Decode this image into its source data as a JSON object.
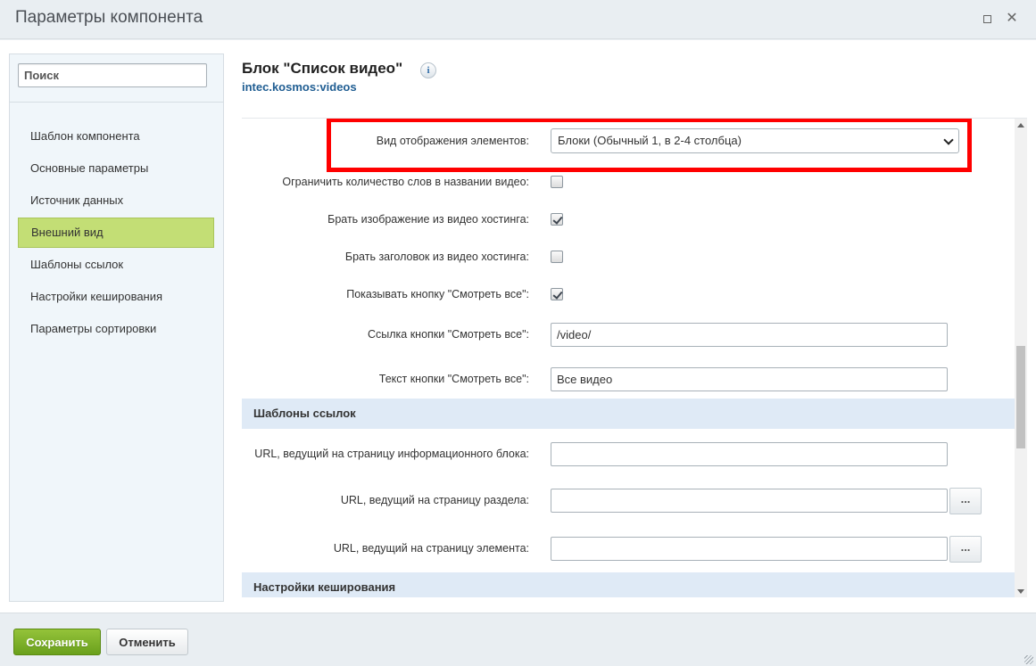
{
  "window": {
    "title": "Параметры компонента",
    "maximize_icon": "maximize-icon",
    "close_glyph": "✕"
  },
  "sidebar": {
    "search_placeholder": "Поиск",
    "items": [
      {
        "label": "Шаблон компонента",
        "active": false
      },
      {
        "label": "Основные параметры",
        "active": false
      },
      {
        "label": "Источник данных",
        "active": false
      },
      {
        "label": "Внешний вид",
        "active": true
      },
      {
        "label": "Шаблоны ссылок",
        "active": false
      },
      {
        "label": "Настройки кеширования",
        "active": false
      },
      {
        "label": "Параметры сортировки",
        "active": false
      }
    ]
  },
  "main": {
    "block_title": "Блок \"Список видео\"",
    "info_glyph": "i",
    "block_code": "intec.kosmos:videos",
    "appearance": {
      "view_mode_label": "Вид отображения элементов:",
      "view_mode_value": "Блоки (Обычный 1, в 2-4 столбца)",
      "limit_words_label": "Ограничить количество слов в названии видео:",
      "limit_words_checked": false,
      "image_from_hosting_label": "Брать изображение из видео хостинга:",
      "image_from_hosting_checked": true,
      "title_from_hosting_label": "Брать заголовок из видео хостинга:",
      "title_from_hosting_checked": false,
      "show_all_button_label": "Показывать кнопку \"Смотреть все\":",
      "show_all_button_checked": true,
      "show_all_link_label": "Ссылка кнопки \"Смотреть все\":",
      "show_all_link_value": "/video/",
      "show_all_text_label": "Текст кнопки \"Смотреть все\":",
      "show_all_text_value": "Все видео"
    },
    "link_templates": {
      "section_title": "Шаблоны ссылок",
      "iblock_url_label": "URL, ведущий на страницу информационного блока:",
      "iblock_url_value": "",
      "section_url_label": "URL, ведущий на страницу раздела:",
      "section_url_value": "",
      "element_url_label": "URL, ведущий на страницу элемента:",
      "element_url_value": "",
      "browse_button": "..."
    },
    "caching": {
      "section_title": "Настройки кеширования"
    }
  },
  "footer": {
    "save_label": "Сохранить",
    "cancel_label": "Отменить"
  },
  "colors": {
    "highlight": "#ff0000",
    "active_nav": "#c3de75",
    "save_button": "#7cb028",
    "section_header": "#dfeaf6",
    "link_code": "#1f5d92"
  }
}
